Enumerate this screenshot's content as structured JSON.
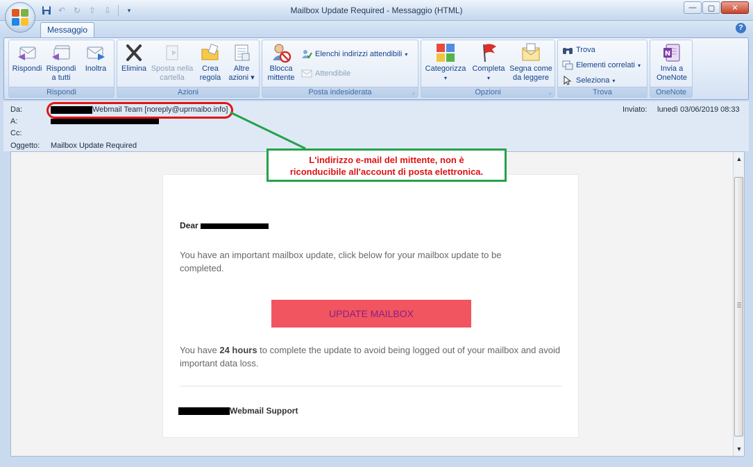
{
  "window": {
    "title": "Mailbox Update Required - Messaggio (HTML)",
    "tab": "Messaggio",
    "help": "?"
  },
  "ribbon": {
    "rispondi": {
      "label": "Rispondi",
      "reply": "Rispondi",
      "reply_all_1": "Rispondi",
      "reply_all_2": "a tutti",
      "forward": "Inoltra"
    },
    "azioni": {
      "label": "Azioni",
      "delete": "Elimina",
      "move_1": "Sposta nella",
      "move_2": "cartella",
      "rule_1": "Crea",
      "rule_2": "regola",
      "other_1": "Altre",
      "other_2": "azioni"
    },
    "posta": {
      "label": "Posta indesiderata",
      "block_1": "Blocca",
      "block_2": "mittente",
      "safe_lists": "Elenchi indirizzi attendibili",
      "trusted": "Attendibile"
    },
    "opzioni": {
      "label": "Opzioni",
      "categorize": "Categorizza",
      "followup": "Completa",
      "mark_1": "Segna come",
      "mark_2": "da leggere"
    },
    "trova": {
      "label": "Trova",
      "find": "Trova",
      "related": "Elementi correlati",
      "select": "Seleziona"
    },
    "onenote": {
      "label": "OneNote",
      "send_1": "Invia a",
      "send_2": "OneNote"
    }
  },
  "header": {
    "from_label": "Da:",
    "from_value": "Webmail Team [noreply@uprmaibo.info]",
    "to_label": "A:",
    "cc_label": "Cc:",
    "subject_label": "Oggetto:",
    "subject_value": "Mailbox Update Required",
    "sent_label": "Inviato:",
    "sent_value": "lunedì 03/06/2019 08:33"
  },
  "message": {
    "dear": "Dear",
    "paragraph1": "You have an important mailbox update, click below for your mailbox update to be completed.",
    "button": "UPDATE MAILBOX",
    "p2_before": "You have ",
    "p2_bold": "24 hours",
    "p2_after": " to complete the update to avoid being logged out of your mailbox and avoid important data loss.",
    "signature": "Webmail Support"
  },
  "annotation": {
    "line1": "L'indirizzo e-mail del mittente, non è",
    "line2": "riconducibile all'account di posta elettronica."
  },
  "colors": {
    "annotation_border": "#25a24a",
    "annotation_text": "#dd1313",
    "highlight_oval": "#e21414",
    "cta_background": "#f1555f"
  }
}
